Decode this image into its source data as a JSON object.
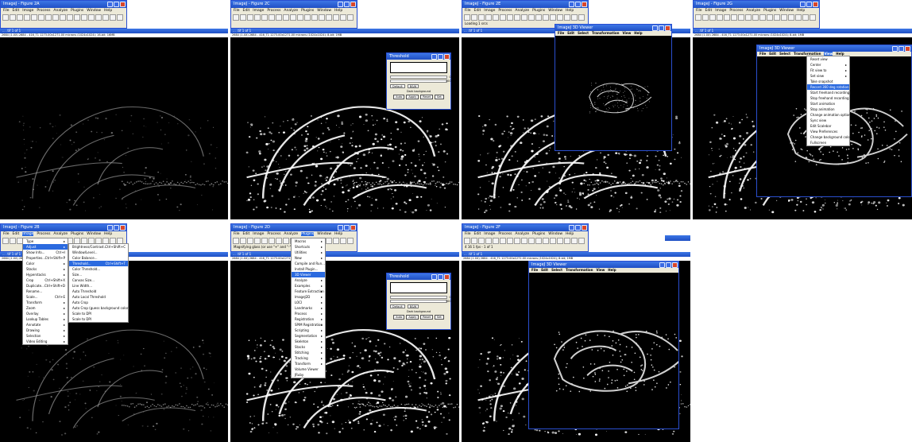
{
  "menus": {
    "main": [
      "File",
      "Edit",
      "Image",
      "Process",
      "Analyze",
      "Plugins",
      "Window",
      "Help"
    ],
    "viewer": [
      "File",
      "Edit",
      "Select",
      "Transformation",
      "View",
      "Help"
    ]
  },
  "panels": [
    {
      "id": "2A",
      "title": "ImageJ - Figure 2A",
      "img_title": "... .tif 1 of 1",
      "info": "2684 (1.0X) 2684 - 416_T1 1273.00x1271.00 microns (1024x1024); 16-bit; 16MB",
      "menu_highlight": "",
      "status": ""
    },
    {
      "id": "2C",
      "title": "ImageJ - Figure 2C",
      "img_title": "... .tif 1 of 1",
      "info": "2684 (1.0X) 2684 - 416_T1 1273.00x1271.00 microns (1024x1024); 8-bit; 1MB",
      "menu_highlight": "",
      "status": ""
    },
    {
      "id": "2E",
      "title": "ImageJ - Figure 2E",
      "img_title": "... .tif 1 of 1",
      "info": "",
      "menu_highlight": "",
      "status": "Loading 1 srcs"
    },
    {
      "id": "2G",
      "title": "ImageJ - Figure 2G",
      "img_title": "... .tif 1 of 1",
      "info": "2684 (1.0X) 2684 - 416_T1 1273.00x1271.00 microns (1024x1024); 8-bit; 1MB",
      "menu_highlight": "",
      "status": ""
    },
    {
      "id": "2B",
      "title": "ImageJ - Figure 2B",
      "img_title": "... .tif 1 of 1",
      "info": "2684 (1.0X) 2684",
      "menu_highlight": "Image",
      "status": ""
    },
    {
      "id": "2D",
      "title": "ImageJ - Figure 2D",
      "img_title": "... .tif 1 of 1",
      "info": "2684 (1.0X) 2684 - 416_T1 1273.00x1271.00",
      "menu_highlight": "Plugins",
      "status": "Magnifying glass (or use \"+\" and \"-\" keys)"
    },
    {
      "id": "2F",
      "title": "ImageJ - Figure 2F",
      "img_title": "... .tif 1 of 1",
      "info": "2684 (1.0X) 2684 - 416_T1 1273.00x1271.00 microns (1024x1024); 8-bit; 1MB",
      "menu_highlight": "",
      "status": "4 16 1 fps - 1 of 1"
    }
  ],
  "threshold": {
    "title": "Threshold",
    "slider_labels": [
      "0 %",
      "100 %"
    ],
    "method": "Default",
    "mode": "B&W",
    "dark_bg": "Dark background",
    "buttons": [
      "Auto",
      "Apply",
      "Reset",
      "Set"
    ]
  },
  "viewer_title": "ImageJ 3D Viewer",
  "image_menu": {
    "items": [
      {
        "label": "Type",
        "sc": "",
        "sub": true
      },
      {
        "label": "Adjust",
        "sc": "",
        "sub": true,
        "hl": true
      },
      {
        "label": "Show Info...",
        "sc": "Ctrl+I",
        "sub": false
      },
      {
        "label": "Properties...",
        "sc": "Ctrl+Shift+P",
        "sub": false
      },
      {
        "label": "Color",
        "sc": "",
        "sub": true
      },
      {
        "label": "Stacks",
        "sc": "",
        "sub": true
      },
      {
        "label": "Hyperstacks",
        "sc": "",
        "sub": true
      },
      {
        "label": "Crop",
        "sc": "Ctrl+Shift+X",
        "sub": false
      },
      {
        "label": "Duplicate...",
        "sc": "Ctrl+Shift+D",
        "sub": false
      },
      {
        "label": "Rename...",
        "sc": "",
        "sub": false
      },
      {
        "label": "Scale...",
        "sc": "Ctrl+E",
        "sub": false
      },
      {
        "label": "Transform",
        "sc": "",
        "sub": true
      },
      {
        "label": "Zoom",
        "sc": "",
        "sub": true
      },
      {
        "label": "Overlay",
        "sc": "",
        "sub": true
      },
      {
        "label": "Lookup Tables",
        "sc": "",
        "sub": true
      },
      {
        "label": "Annotate",
        "sc": "",
        "sub": true
      },
      {
        "label": "Drawing",
        "sc": "",
        "sub": true
      },
      {
        "label": "Selection",
        "sc": "",
        "sub": true
      },
      {
        "label": "Video Editing",
        "sc": "",
        "sub": true
      }
    ]
  },
  "adjust_menu": {
    "items": [
      {
        "label": "Brightness/Contrast...",
        "sc": "Ctrl+Shift+C",
        "hl": false
      },
      {
        "label": "Window/Level...",
        "sc": "",
        "hl": false
      },
      {
        "label": "Color Balance...",
        "sc": "",
        "hl": false
      },
      {
        "label": "Threshold...",
        "sc": "Ctrl+Shift+T",
        "hl": true
      },
      {
        "label": "Color Threshold...",
        "sc": "",
        "hl": false
      },
      {
        "label": "Size...",
        "sc": "",
        "hl": false
      },
      {
        "label": "Canvas Size...",
        "sc": "",
        "hl": false
      },
      {
        "label": "Line Width...",
        "sc": "",
        "hl": false
      },
      {
        "label": "Auto Threshold",
        "sc": "",
        "hl": false
      },
      {
        "label": "Auto Local Threshold",
        "sc": "",
        "hl": false
      },
      {
        "label": "Auto Crop",
        "sc": "",
        "hl": false
      },
      {
        "label": "Auto Crop (guess background color)",
        "sc": "",
        "hl": false
      },
      {
        "label": "Scale to DPI",
        "sc": "",
        "hl": false
      },
      {
        "label": "Scale to DPI",
        "sc": "",
        "hl": false
      }
    ]
  },
  "plugins_menu": {
    "items": [
      {
        "label": "Macros",
        "sub": true,
        "hl": false
      },
      {
        "label": "Shortcuts",
        "sub": true,
        "hl": false
      },
      {
        "label": "Utilities",
        "sub": true,
        "hl": false
      },
      {
        "label": "New",
        "sub": true,
        "hl": false
      },
      {
        "label": "Compile and Run...",
        "sub": false,
        "hl": false
      },
      {
        "label": "Install Plugin...",
        "sub": false,
        "hl": false
      },
      {
        "label": "3D Viewer",
        "sub": false,
        "hl": true
      },
      {
        "label": "Analyze",
        "sub": true,
        "hl": false
      },
      {
        "label": "Examples",
        "sub": true,
        "hl": false
      },
      {
        "label": "Feature Extraction",
        "sub": true,
        "hl": false
      },
      {
        "label": "ImageJ2D",
        "sub": true,
        "hl": false
      },
      {
        "label": "LOCI",
        "sub": true,
        "hl": false
      },
      {
        "label": "Landmarks",
        "sub": true,
        "hl": false
      },
      {
        "label": "Process",
        "sub": true,
        "hl": false
      },
      {
        "label": "Registration",
        "sub": true,
        "hl": false
      },
      {
        "label": "SPIM Registration",
        "sub": true,
        "hl": false
      },
      {
        "label": "Scripting",
        "sub": true,
        "hl": false
      },
      {
        "label": "Segmentation",
        "sub": true,
        "hl": false
      },
      {
        "label": "Skeleton",
        "sub": true,
        "hl": false
      },
      {
        "label": "Stacks",
        "sub": true,
        "hl": false
      },
      {
        "label": "Stitching",
        "sub": true,
        "hl": false
      },
      {
        "label": "Tracking",
        "sub": true,
        "hl": false
      },
      {
        "label": "Transform",
        "sub": true,
        "hl": false
      },
      {
        "label": "Volume Viewer",
        "sub": false,
        "hl": false
      },
      {
        "label": "JRuby",
        "sub": false,
        "hl": false
      }
    ]
  },
  "view_menu": {
    "items": [
      {
        "label": "Reset view",
        "sub": false,
        "hl": false
      },
      {
        "label": "Center",
        "sub": true,
        "hl": false
      },
      {
        "label": "Fit view to",
        "sub": true,
        "hl": false
      },
      {
        "label": "Set view",
        "sub": true,
        "hl": false
      },
      {
        "label": "Take snapshot",
        "sub": false,
        "hl": false
      },
      {
        "label": "Record 360 deg rotation",
        "sub": false,
        "hl": true
      },
      {
        "label": "Start freehand recording",
        "sub": false,
        "hl": false
      },
      {
        "label": "Stop freehand recording",
        "sub": false,
        "hl": false
      },
      {
        "label": "Start animation",
        "sub": false,
        "hl": false
      },
      {
        "label": "Stop animation",
        "sub": false,
        "hl": false
      },
      {
        "label": "Change animation options",
        "sub": false,
        "hl": false
      },
      {
        "label": "Sync view",
        "sub": false,
        "hl": false
      },
      {
        "label": "Edit Scalebar",
        "sub": false,
        "hl": false
      },
      {
        "label": "View Preferences",
        "sub": false,
        "hl": false
      },
      {
        "label": "Change background color",
        "sub": false,
        "hl": false
      },
      {
        "label": "Fullscreen",
        "sub": false,
        "hl": false
      }
    ]
  },
  "colors": {
    "xp_blue": "#1f4fc4",
    "menu_highlight": "#2b6adf",
    "image_bg": "#000000",
    "vessel": "#ffffff"
  }
}
